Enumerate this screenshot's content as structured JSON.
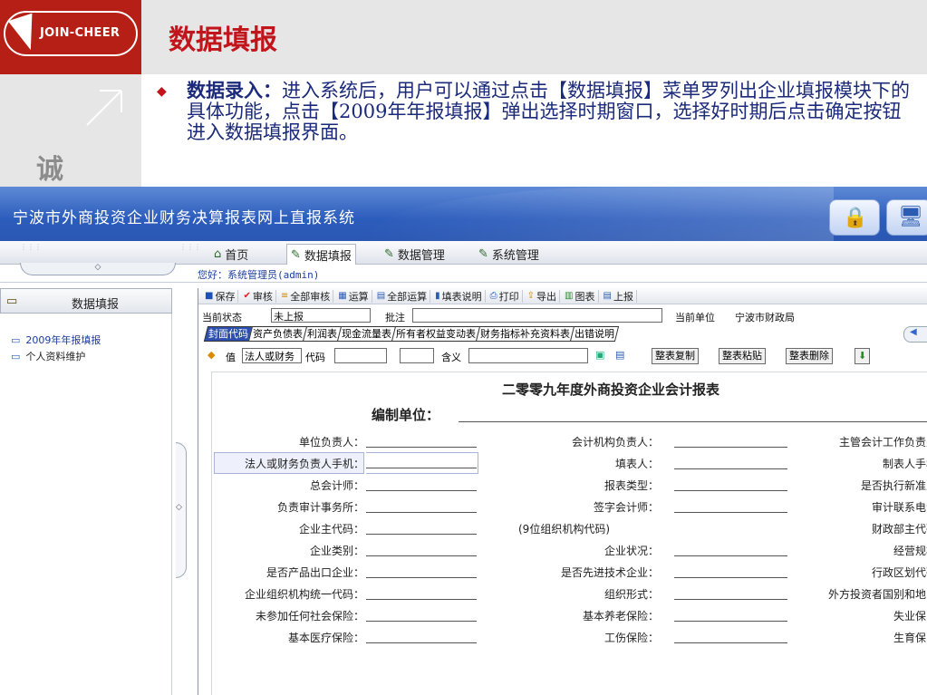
{
  "slide": {
    "logo_text": "JOIN-CHEER",
    "title": "数据填报",
    "side_char": "诚",
    "bullet_bold": "数据录入：",
    "bullet_text": "进入系统后，用户可以通过点击【数据填报】菜单罗列出企业填报模块下的具体功能，点击【2009年年报填报】弹出选择时期窗口，选择好时期后点击确定按钮进入数据填报界面。"
  },
  "app": {
    "system_title": "宁波市外商投资企业财务决算报表网上直报系统",
    "nav": [
      {
        "label": "首页",
        "icon": "home-icon"
      },
      {
        "label": "数据填报",
        "icon": "edit-icon",
        "active": true
      },
      {
        "label": "数据管理",
        "icon": "edit-icon"
      },
      {
        "label": "系统管理",
        "icon": "edit-icon"
      }
    ],
    "greeting": "您好：系统管理员(admin)",
    "sidebar": {
      "title": "数据填报",
      "items": [
        {
          "label": "2009年年报填报",
          "selected": true
        },
        {
          "label": "个人资料维护",
          "selected": false
        }
      ]
    },
    "toolbar": [
      {
        "label": "保存",
        "icon": "save-icon",
        "color": "#1d4fb8"
      },
      {
        "label": "审核",
        "icon": "check-icon",
        "color": "#d22"
      },
      {
        "label": "全部审核",
        "icon": "check-all-icon",
        "color": "#c80"
      },
      {
        "label": "运算",
        "icon": "calc-icon",
        "color": "#2b5cb4"
      },
      {
        "label": "全部运算",
        "icon": "calc-all-icon",
        "color": "#2b5cb4"
      },
      {
        "label": "填表说明",
        "icon": "book-icon",
        "color": "#2b5cb4"
      },
      {
        "label": "打印",
        "icon": "print-icon",
        "color": "#2b5cb4"
      },
      {
        "label": "导出",
        "icon": "export-icon",
        "color": "#c80"
      },
      {
        "label": "图表",
        "icon": "chart-icon",
        "color": "#2a8a2a"
      },
      {
        "label": "上报",
        "icon": "upload-icon",
        "color": "#2b5cb4"
      }
    ],
    "status": {
      "state_label": "当前状态",
      "state_value": "未上报",
      "note_label": "批注",
      "note_value": "",
      "unit_label": "当前单位",
      "unit_value": "宁波市财政局"
    },
    "tabs": [
      "封面代码",
      "资产负债表",
      "利润表",
      "现金流量表",
      "所有者权益变动表",
      "财务指标补充资料表",
      "出错说明"
    ],
    "value_row": {
      "value_label": "值",
      "value_field": "法人或财务",
      "code_label": "代码",
      "code_value": "",
      "meaning_label": "含义",
      "meaning_value": "",
      "buttons": [
        "整表复制",
        "整表粘贴",
        "整表删除"
      ]
    },
    "report": {
      "title": "二零零九年度外商投资企业会计报表",
      "unit_label": "编制单位：",
      "rows": [
        {
          "c1": "单位负责人：",
          "c2": "会计机构负责人：",
          "c3": "主管会计工作负责人"
        },
        {
          "c1": "法人或财务负责人手机：",
          "c2": "填表人：",
          "c3": "制表人手机"
        },
        {
          "c1": "总会计师：",
          "c2": "报表类型：",
          "c3": "是否执行新准则"
        },
        {
          "c1": "负责审计事务所：",
          "c2": "签字会计师：",
          "c3": "审计联系电话"
        },
        {
          "c1": "企业主代码：",
          "c2": "(9位组织机构代码)",
          "c3": "财政部主代码"
        },
        {
          "c1": "企业类别：",
          "c2": "企业状况：",
          "c3": "经营规模"
        },
        {
          "c1": "是否产品出口企业：",
          "c2": "是否先进技术企业：",
          "c3": "行政区划代码"
        },
        {
          "c1": "企业组织机构统一代码：",
          "c2": "组织形式：",
          "c3": "外方投资者国别和地区"
        },
        {
          "c1": "未参加任何社会保险：",
          "c2": "基本养老保险：",
          "c3": "失业保险"
        },
        {
          "c1": "基本医疗保险：",
          "c2": "工伤保险：",
          "c3": "生育保险"
        }
      ]
    }
  }
}
